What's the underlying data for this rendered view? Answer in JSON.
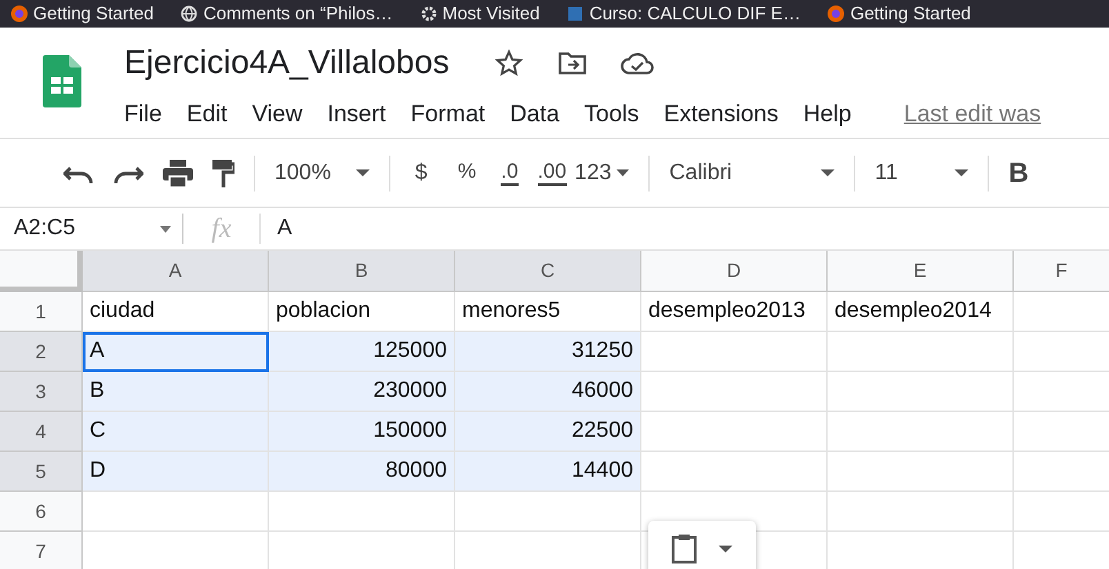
{
  "bookmarks": [
    {
      "label": "Getting Started",
      "kind": "firefox"
    },
    {
      "label": "Comments on “Philos…",
      "kind": "globe"
    },
    {
      "label": "Most Visited",
      "kind": "gear"
    },
    {
      "label": "Curso: CALCULO DIF E…",
      "kind": "course"
    },
    {
      "label": "Getting Started",
      "kind": "firefox"
    }
  ],
  "document": {
    "title": "Ejercicio4A_Villalobos",
    "starred": false
  },
  "menu": [
    "File",
    "Edit",
    "View",
    "Insert",
    "Format",
    "Data",
    "Tools",
    "Extensions",
    "Help"
  ],
  "last_edit": "Last edit was",
  "toolbar": {
    "zoom": "100%",
    "currency": "$",
    "percent": "%",
    "decrease_decimals": ".0",
    "increase_decimals": ".00",
    "number_format": "123",
    "font": "Calibri",
    "font_size": "11",
    "bold": "B"
  },
  "name_box": "A2:C5",
  "fx": "fx",
  "formula": "A",
  "columns": [
    {
      "label": "A",
      "selected": true
    },
    {
      "label": "B",
      "selected": true
    },
    {
      "label": "C",
      "selected": true
    },
    {
      "label": "D",
      "selected": false
    },
    {
      "label": "E",
      "selected": false
    },
    {
      "label": "F",
      "selected": false
    }
  ],
  "rows": [
    {
      "label": "1",
      "selected": false,
      "cells": [
        {
          "text": "ciudad",
          "kind": "text",
          "active": false
        },
        {
          "text": "poblacion",
          "kind": "text",
          "active": false
        },
        {
          "text": "menores5",
          "kind": "text",
          "active": false
        },
        {
          "text": "desempleo2013",
          "kind": "text",
          "active": false
        },
        {
          "text": "desempleo2014",
          "kind": "text",
          "active": false
        }
      ]
    },
    {
      "label": "2",
      "selected": true,
      "cells": [
        {
          "text": "A",
          "kind": "text",
          "active": true
        },
        {
          "text": "125000",
          "kind": "number",
          "active": false
        },
        {
          "text": "31250",
          "kind": "number",
          "active": false
        }
      ]
    },
    {
      "label": "3",
      "selected": true,
      "cells": [
        {
          "text": "B",
          "kind": "text",
          "active": false
        },
        {
          "text": "230000",
          "kind": "number",
          "active": false
        },
        {
          "text": "46000",
          "kind": "number",
          "active": false
        }
      ]
    },
    {
      "label": "4",
      "selected": true,
      "cells": [
        {
          "text": "C",
          "kind": "text",
          "active": false
        },
        {
          "text": "150000",
          "kind": "number",
          "active": false
        },
        {
          "text": "22500",
          "kind": "number",
          "active": false
        }
      ]
    },
    {
      "label": "5",
      "selected": true,
      "cells": [
        {
          "text": "D",
          "kind": "text",
          "active": false
        },
        {
          "text": "80000",
          "kind": "number",
          "active": false
        },
        {
          "text": "14400",
          "kind": "number",
          "active": false
        }
      ]
    },
    {
      "label": "6",
      "selected": false,
      "cells": []
    },
    {
      "label": "7",
      "selected": false,
      "cells": []
    }
  ]
}
